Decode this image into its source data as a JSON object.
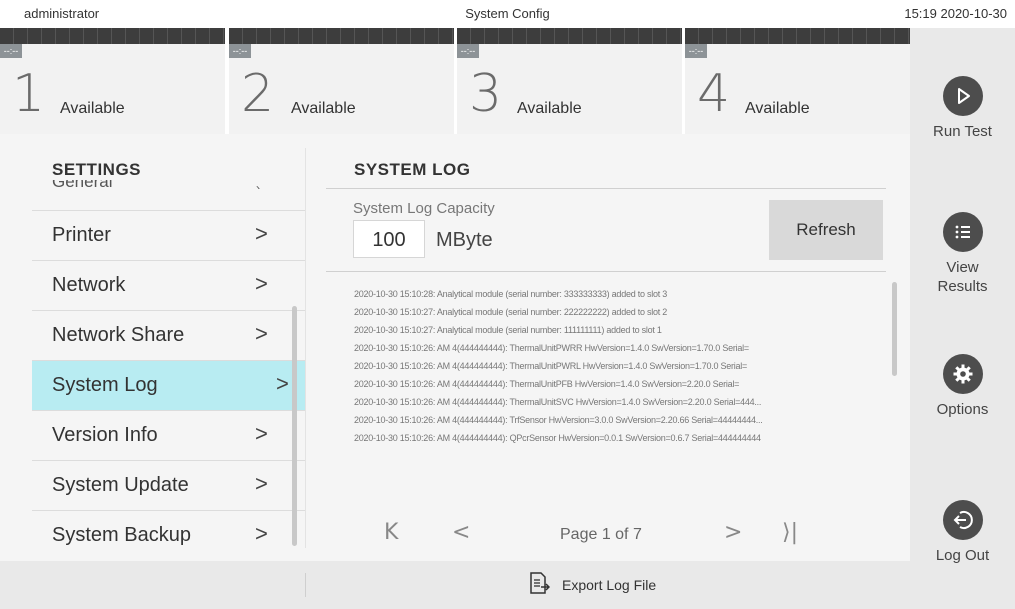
{
  "header": {
    "user": "administrator",
    "title": "System Config",
    "datetime": "15:19 2020-10-30"
  },
  "modules": [
    {
      "tag": "--:--",
      "number": "1",
      "status": "Available"
    },
    {
      "tag": "--:--",
      "number": "2",
      "status": "Available"
    },
    {
      "tag": "--:--",
      "number": "3",
      "status": "Available"
    },
    {
      "tag": "--:--",
      "number": "4",
      "status": "Available"
    }
  ],
  "rail": {
    "run_test": "Run Test",
    "view_results_1": "View",
    "view_results_2": "Results",
    "options": "Options",
    "log_out": "Log Out"
  },
  "sidebar": {
    "title": "SETTINGS",
    "partial_item": "General",
    "items": [
      {
        "label": "Printer"
      },
      {
        "label": "Network"
      },
      {
        "label": "Network Share"
      },
      {
        "label": "System Log"
      },
      {
        "label": "Version Info"
      },
      {
        "label": "System Update"
      },
      {
        "label": "System Backup"
      }
    ],
    "active_index": 3
  },
  "panel": {
    "title": "SYSTEM LOG",
    "capacity_label": "System Log Capacity",
    "capacity_value": "100",
    "capacity_unit": "MByte",
    "refresh_label": "Refresh",
    "log_lines": [
      "2020-10-30 15:10:28: Analytical module (serial number: 333333333) added to slot 3",
      "2020-10-30 15:10:27: Analytical module (serial number: 222222222) added to slot 2",
      "2020-10-30 15:10:27: Analytical module (serial number: 111111111) added to slot 1",
      "2020-10-30 15:10:26: AM 4(444444444): ThermalUnitPWRR HwVersion=1.4.0 SwVersion=1.70.0 Serial=",
      "2020-10-30 15:10:26: AM 4(444444444): ThermalUnitPWRL HwVersion=1.4.0 SwVersion=1.70.0 Serial=",
      "2020-10-30 15:10:26: AM 4(444444444): ThermalUnitPFB HwVersion=1.4.0 SwVersion=2.20.0 Serial=",
      "2020-10-30 15:10:26: AM 4(444444444): ThermalUnitSVC HwVersion=1.4.0 SwVersion=2.20.0 Serial=444...",
      "2020-10-30 15:10:26: AM 4(444444444): TrfSensor HwVersion=3.0.0 SwVersion=2.20.66 Serial=44444444...",
      "2020-10-30 15:10:26: AM 4(444444444): QPcrSensor HwVersion=0.0.1 SwVersion=0.6.7 Serial=444444444"
    ],
    "pager": {
      "first": "K",
      "prev": "<",
      "page_text": "Page 1 of 7",
      "next": ">",
      "last": "⟩|"
    }
  },
  "footer": {
    "export_label": "Export Log File"
  },
  "icons": {
    "run": "play-icon",
    "results": "list-icon",
    "options": "gear-icon",
    "logout": "logout-icon",
    "export": "export-file-icon"
  },
  "colors": {
    "active_item": "#b8ecf2",
    "rail_icon": "#4d4d4d",
    "module_band": "#3d3d3d"
  }
}
